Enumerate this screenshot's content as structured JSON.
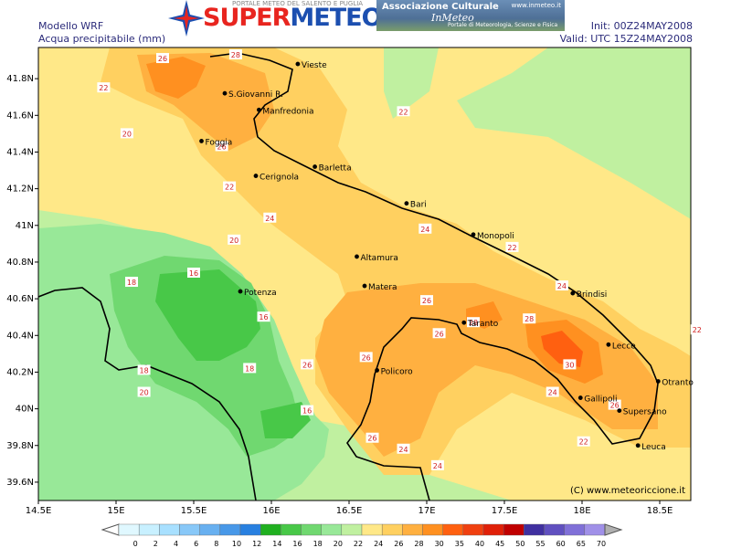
{
  "header": {
    "model": "Modello WRF",
    "variable": "Acqua precipitabile (mm)",
    "init": "Init: 00Z24MAY2008",
    "valid": "Valid: UTC 15Z24MAY2008"
  },
  "logos": {
    "brand_part1": "SUPER",
    "brand_part2": "METEO",
    "brand_tagline": "PORTALE METEO DEL SALENTO E PUGLIA",
    "assoc_title": "Associazione Culturale",
    "assoc_name": "InMeteo",
    "assoc_sub": "Portale di Meteorologia, Scienze e Fisica",
    "assoc_url": "www.inmeteo.it"
  },
  "copyright": "(C) www.meteoriccione.it",
  "axes": {
    "lon_ticks": [
      "14.5E",
      "15E",
      "15.5E",
      "16E",
      "16.5E",
      "17E",
      "17.5E",
      "18E",
      "18.5E"
    ],
    "lat_ticks": [
      "41.8N",
      "41.6N",
      "41.4N",
      "41.2N",
      "41N",
      "40.8N",
      "40.6N",
      "40.4N",
      "40.2N",
      "40N",
      "39.8N",
      "39.6N"
    ]
  },
  "cities": [
    {
      "name": "Vieste",
      "lon": 16.17,
      "lat": 41.88
    },
    {
      "name": "S.Giovanni R.",
      "lon": 15.7,
      "lat": 41.72
    },
    {
      "name": "Manfredonia",
      "lon": 15.92,
      "lat": 41.63
    },
    {
      "name": "Foggia",
      "lon": 15.55,
      "lat": 41.46
    },
    {
      "name": "Barletta",
      "lon": 16.28,
      "lat": 41.32
    },
    {
      "name": "Cerignola",
      "lon": 15.9,
      "lat": 41.27
    },
    {
      "name": "Bari",
      "lon": 16.87,
      "lat": 41.12
    },
    {
      "name": "Monopoli",
      "lon": 17.3,
      "lat": 40.95
    },
    {
      "name": "Altamura",
      "lon": 16.55,
      "lat": 40.83
    },
    {
      "name": "Brindisi",
      "lon": 17.94,
      "lat": 40.63
    },
    {
      "name": "Matera",
      "lon": 16.6,
      "lat": 40.67
    },
    {
      "name": "Potenza",
      "lon": 15.8,
      "lat": 40.64
    },
    {
      "name": "Taranto",
      "lon": 17.24,
      "lat": 40.47
    },
    {
      "name": "Lecce",
      "lon": 18.17,
      "lat": 40.35
    },
    {
      "name": "Policoro",
      "lon": 16.68,
      "lat": 40.21
    },
    {
      "name": "Otranto",
      "lon": 18.49,
      "lat": 40.15
    },
    {
      "name": "Gallipoli",
      "lon": 17.99,
      "lat": 40.06
    },
    {
      "name": "Supersano",
      "lon": 18.24,
      "lat": 39.99
    },
    {
      "name": "Leuca",
      "lon": 18.36,
      "lat": 39.8
    }
  ],
  "contour_labels": [
    {
      "v": "28",
      "lon": 15.77,
      "lat": 41.93
    },
    {
      "v": "26",
      "lon": 15.3,
      "lat": 41.91
    },
    {
      "v": "22",
      "lon": 14.92,
      "lat": 41.75
    },
    {
      "v": "20",
      "lon": 15.07,
      "lat": 41.5
    },
    {
      "v": "26",
      "lon": 15.68,
      "lat": 41.43
    },
    {
      "v": "22",
      "lon": 16.85,
      "lat": 41.62
    },
    {
      "v": "22",
      "lon": 15.73,
      "lat": 41.21
    },
    {
      "v": "24",
      "lon": 15.99,
      "lat": 41.04
    },
    {
      "v": "20",
      "lon": 15.76,
      "lat": 40.92
    },
    {
      "v": "24",
      "lon": 16.99,
      "lat": 40.98
    },
    {
      "v": "22",
      "lon": 17.55,
      "lat": 40.88
    },
    {
      "v": "16",
      "lon": 15.5,
      "lat": 40.74
    },
    {
      "v": "18",
      "lon": 15.1,
      "lat": 40.69
    },
    {
      "v": "24",
      "lon": 17.87,
      "lat": 40.67
    },
    {
      "v": "26",
      "lon": 17.0,
      "lat": 40.59
    },
    {
      "v": "16",
      "lon": 15.95,
      "lat": 40.5
    },
    {
      "v": "28",
      "lon": 17.3,
      "lat": 40.47
    },
    {
      "v": "28",
      "lon": 17.66,
      "lat": 40.49
    },
    {
      "v": "26",
      "lon": 17.08,
      "lat": 40.41
    },
    {
      "v": "22",
      "lon": 18.74,
      "lat": 40.43
    },
    {
      "v": "26",
      "lon": 16.61,
      "lat": 40.28
    },
    {
      "v": "26",
      "lon": 16.23,
      "lat": 40.24
    },
    {
      "v": "18",
      "lon": 15.18,
      "lat": 40.21
    },
    {
      "v": "18",
      "lon": 15.86,
      "lat": 40.22
    },
    {
      "v": "30",
      "lon": 17.92,
      "lat": 40.24
    },
    {
      "v": "20",
      "lon": 15.18,
      "lat": 40.09
    },
    {
      "v": "24",
      "lon": 17.81,
      "lat": 40.09
    },
    {
      "v": "26",
      "lon": 18.21,
      "lat": 40.02
    },
    {
      "v": "16",
      "lon": 16.23,
      "lat": 39.99
    },
    {
      "v": "26",
      "lon": 16.65,
      "lat": 39.84
    },
    {
      "v": "22",
      "lon": 18.01,
      "lat": 39.82
    },
    {
      "v": "24",
      "lon": 16.85,
      "lat": 39.78
    },
    {
      "v": "24",
      "lon": 17.07,
      "lat": 39.69
    }
  ],
  "legend": {
    "values": [
      "0",
      "2",
      "4",
      "6",
      "8",
      "10",
      "12",
      "14",
      "16",
      "18",
      "20",
      "22",
      "24",
      "26",
      "28",
      "30",
      "35",
      "40",
      "45",
      "50",
      "55",
      "60",
      "65",
      "70"
    ],
    "colors": [
      "#e0f8ff",
      "#c8f0ff",
      "#a8e0ff",
      "#88c8f8",
      "#68b0f0",
      "#4898e8",
      "#2880e0",
      "#20b020",
      "#48c848",
      "#70d870",
      "#98e898",
      "#c0f0a0",
      "#ffe888",
      "#ffd060",
      "#ffb040",
      "#ff9020",
      "#ff6010",
      "#f04010",
      "#e02008",
      "#c00000",
      "#4030a0",
      "#6050c0",
      "#8070d8",
      "#a090e8",
      "#c8c0f0"
    ]
  }
}
